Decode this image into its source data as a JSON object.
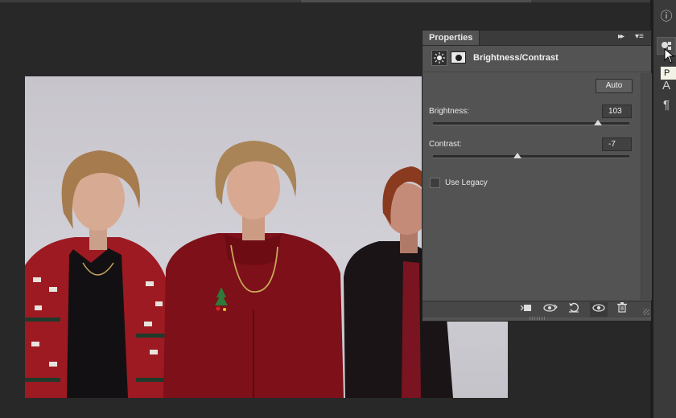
{
  "panel": {
    "tab_label": "Properties",
    "collapse_glyph": "▸▸",
    "menu_glyph": "▾≡",
    "adjustment_title": "Brightness/Contrast",
    "auto_label": "Auto",
    "brightness": {
      "label": "Brightness:",
      "value": "103",
      "slider_fraction": 0.84
    },
    "contrast": {
      "label": "Contrast:",
      "value": "-7",
      "slider_fraction": 0.43
    },
    "use_legacy": {
      "label": "Use Legacy",
      "checked": false
    },
    "bottom_icons": [
      "clip-to-layer-icon",
      "view-previous-state-icon",
      "reset-icon",
      "visibility-eye-icon",
      "trash-icon"
    ]
  },
  "dock": {
    "tooltip_text": "P",
    "icons": [
      "info-icon",
      "adjustments-properties-icon",
      "character-icon",
      "paragraph-icon"
    ]
  },
  "photo": {
    "icon": "group-photo-image"
  },
  "colors": {
    "panel_bg": "#535353",
    "app_bg": "#282828",
    "dock_bg": "#3a3a3a"
  }
}
